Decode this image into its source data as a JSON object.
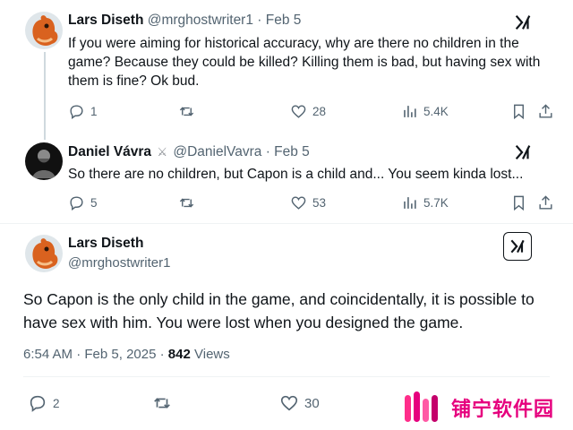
{
  "tweets": [
    {
      "name": "Lars Diseth",
      "handle": "@mrghostwriter1",
      "sep": "·",
      "date": "Feb 5",
      "text": "If you were aiming for historical accuracy, why are there no children in the game? Because they could be killed? Killing them is bad, but having sex with them is fine? Ok bud.",
      "replies": "1",
      "reposts": "",
      "likes": "28",
      "views": "5.4K"
    },
    {
      "name": "Daniel Vávra",
      "badge": "⚔",
      "handle": "@DanielVavra",
      "sep": "·",
      "date": "Feb 5",
      "text": "So there are no children, but Capon is a child and... You seem kinda lost...",
      "replies": "5",
      "reposts": "",
      "likes": "53",
      "views": "5.7K"
    }
  ],
  "main": {
    "name": "Lars Diseth",
    "handle": "@mrghostwriter1",
    "text": "So Capon is the only child in the game, and coincidentally, it is possible to have sex with him. You were lost when you designed the game.",
    "time": "6:54 AM",
    "sep": "·",
    "date": "Feb 5, 2025",
    "sep2": "·",
    "views_count": "842",
    "views_label": "Views",
    "replies": "2",
    "reposts": "",
    "likes": "30"
  },
  "watermark": {
    "text": "铺宁软件园"
  },
  "colors": {
    "muted": "#536471",
    "text": "#0f1419",
    "watermark": "#e6007e"
  },
  "icons": [
    "grok-icon",
    "reply-icon",
    "repost-icon",
    "like-icon",
    "views-icon",
    "bookmark-icon",
    "share-icon"
  ]
}
